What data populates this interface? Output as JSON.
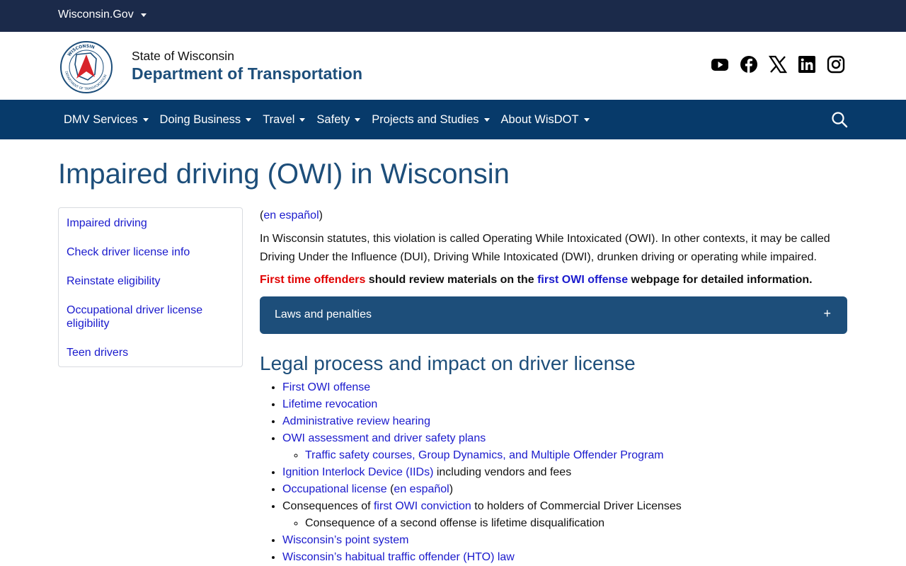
{
  "topbar": {
    "site_label": "Wisconsin.Gov"
  },
  "header": {
    "brand_top": "State of Wisconsin",
    "brand_main": "Department of Transportation",
    "logo_text": "WISCONSIN DEPARTMENT OF TRANSPORTATION",
    "social_icons": [
      "youtube-icon",
      "facebook-icon",
      "x-icon",
      "linkedin-icon",
      "instagram-icon"
    ]
  },
  "nav": {
    "items": [
      {
        "label": "DMV Services"
      },
      {
        "label": "Doing Business"
      },
      {
        "label": "Travel"
      },
      {
        "label": "Safety"
      },
      {
        "label": "Projects and Studies"
      },
      {
        "label": "About WisDOT"
      }
    ]
  },
  "page": {
    "title": "Impaired driving (OWI) in Wisconsin"
  },
  "sidenav": {
    "items": [
      {
        "label": "Impaired driving"
      },
      {
        "label": "Check driver license info"
      },
      {
        "label": "Reinstate eligibility"
      },
      {
        "label": "Occupational driver license eligibility"
      },
      {
        "label": "Teen drivers"
      }
    ]
  },
  "main": {
    "lang_link": "en español",
    "intro": "In Wisconsin statutes, this violation is called Operating While Intoxicated (OWI). In other contexts, it may be called Driving Under the Influence (DUI), Driving While Intoxicated (DWI), drunken driving or operating while impaired.",
    "notice": {
      "red_text": "First time offenders",
      "text1": " should review materials on the ",
      "link": "first OWI offense",
      "text2": " webpage for detailed information."
    },
    "accordion": {
      "label": "Laws and penalties",
      "icon": "+"
    },
    "section_title": "Legal process and impact on driver license",
    "list": {
      "item1": "First OWI offense",
      "item2": "Lifetime revocation",
      "item3": "Administrative review hearing",
      "item4": "OWI assessment and driver safety plans",
      "item4_sub": "Traffic safety courses, Group Dynamics, and Multiple Offender Program",
      "item5_link": "Ignition Interlock Device (IIDs)",
      "item5_text": " including vendors and fees",
      "item6_link": "Occupational license",
      "item6_open": " (",
      "item6_lang": "en español",
      "item6_close": ")",
      "item7_text1": "Consequences of ",
      "item7_link": "first OWI conviction",
      "item7_text2": " to holders of Commercial Driver Licenses",
      "item7_sub": "Consequence of a second offense is lifetime disqualification",
      "item8": "Wisconsin’s point system",
      "item9": "Wisconsin’s habitual traffic offender (HTO) law"
    }
  },
  "colors": {
    "topbar": "#1b2a4a",
    "nav": "#073a6a",
    "brand": "#1d4e7a",
    "link": "#1a1acd",
    "alert_red": "#e10000"
  }
}
